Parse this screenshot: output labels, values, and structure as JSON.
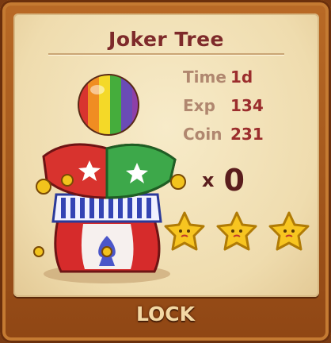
{
  "item": {
    "title": "Joker Tree",
    "art_icon": "jester-hat-with-ball"
  },
  "stats": [
    {
      "label": "Time",
      "value": "1d"
    },
    {
      "label": "Exp",
      "value": "134"
    },
    {
      "label": "Coin",
      "value": "231"
    }
  ],
  "quantity": {
    "prefix": "x",
    "value": "0"
  },
  "rating": {
    "stars_total": 3,
    "stars_filled": 3,
    "star_icon": "star-icon"
  },
  "action": {
    "label": "LOCK"
  },
  "colors": {
    "title": "#7e2a2a",
    "stat_label": "#b0876f",
    "stat_value": "#9b2d2d",
    "star": "#f7c520",
    "frame": "#8f4614",
    "parchment": "#efdcae"
  }
}
